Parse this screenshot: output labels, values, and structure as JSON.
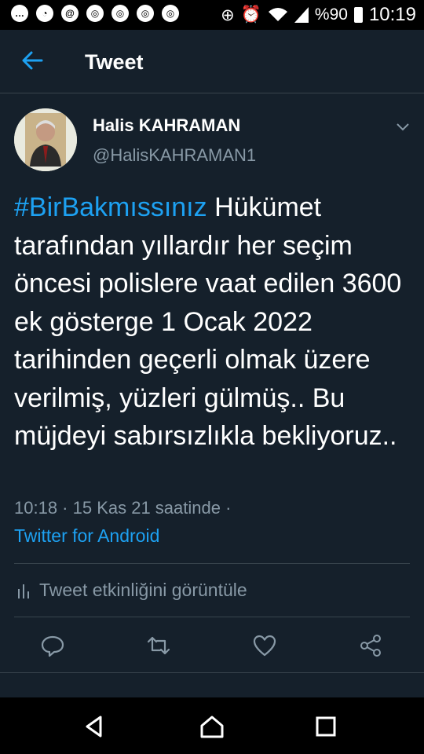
{
  "status_bar": {
    "left_icons": [
      "chat-icon",
      "messenger-icon",
      "at-icon",
      "chrome-icon",
      "chrome-icon",
      "chrome-icon",
      "chrome-icon"
    ],
    "battery_text": "%90",
    "time": "10:19"
  },
  "app_bar": {
    "title": "Tweet"
  },
  "tweet": {
    "author_name": "Halis KAHRAMAN",
    "author_handle": "@HalisKAHRAMAN1",
    "hashtag": "#BirBakmıssınız",
    "body": " Hükümet tarafından yıllardır her seçim öncesi polislere vaat edilen 3600 ek gösterge 1 Ocak 2022 tarihinden geçerli olmak üzere verilmiş, yüzleri gülmüş.. Bu müjdeyi sabırsızlıkla bekliyoruz..",
    "meta": "10:18 · 15 Kas 21 saatinde ·",
    "source": "Twitter for Android",
    "activity_label": "Tweet etkinliğini görüntüle"
  },
  "colors": {
    "background": "#15202b",
    "accent": "#1da1f2",
    "muted": "#8899a6",
    "divider": "#38444d"
  }
}
